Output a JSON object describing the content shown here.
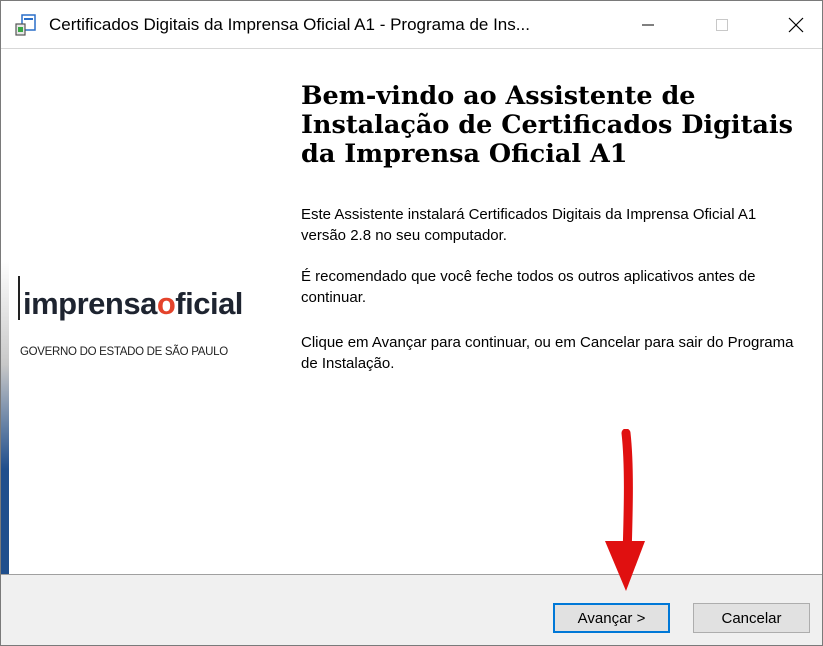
{
  "window": {
    "title": "Certificados Digitais da Imprensa Oficial A1 - Programa de Ins...",
    "minimize_glyph": "—",
    "maximize_glyph": "☐",
    "close_glyph": "✕"
  },
  "sidebar": {
    "logo_part1": "imprensa",
    "logo_part2": "o",
    "logo_part3": "ficial",
    "logo_subtitle": "GOVERNO DO ESTADO DE SÃO PAULO",
    "logo_accent_color": "#e4432b"
  },
  "main": {
    "heading": "Bem-vindo ao Assistente de Instalação de Certificados Digitais da Imprensa Oficial A1",
    "paragraphs": [
      "Este Assistente instalará Certificados Digitais da Imprensa Oficial A1 versão 2.8 no seu computador.",
      "É recomendado que você feche todos os outros aplicativos antes de continuar.",
      "Clique em Avançar para continuar, ou em Cancelar para sair do Programa de Instalação."
    ]
  },
  "buttons": {
    "next_label": "Avançar >",
    "cancel_label": "Cancelar"
  },
  "annotation": {
    "arrow_color": "#e01010"
  }
}
